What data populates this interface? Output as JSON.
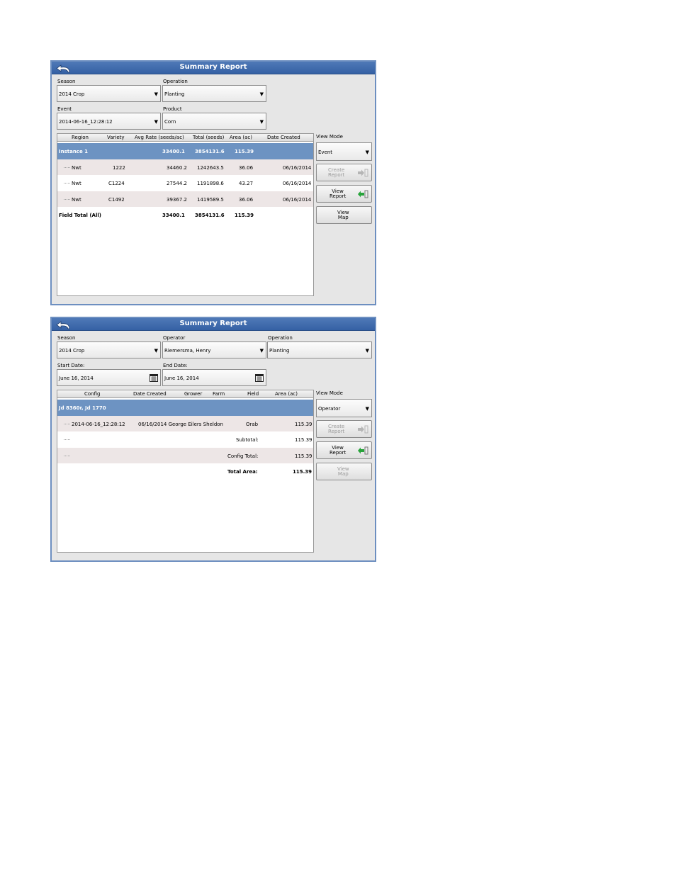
{
  "screen1": {
    "title": "Summary Report",
    "season": {
      "label": "Season",
      "value": "2014 Crop"
    },
    "operation": {
      "label": "Operation",
      "value": "Planting"
    },
    "event": {
      "label": "Event",
      "value": "2014-06-16_12:28:12"
    },
    "product": {
      "label": "Product",
      "value": "Corn"
    },
    "view_mode": {
      "label": "View Mode",
      "value": "Event"
    },
    "columns": [
      "Region",
      "Variety",
      "Avg Rate (seeds/ac)",
      "Total (seeds)",
      "Area (ac)",
      "Date Created"
    ],
    "group": {
      "name": "Instance 1",
      "avg_rate": "33400.1",
      "total": "3854131.6",
      "area": "115.39"
    },
    "rows": [
      {
        "region": "Nwt",
        "variety": "1222",
        "avg_rate": "34460.2",
        "total": "1242643.5",
        "area": "36.06",
        "date": "06/16/2014"
      },
      {
        "region": "Nwt",
        "variety": "C1224",
        "avg_rate": "27544.2",
        "total": "1191898.6",
        "area": "43.27",
        "date": "06/16/2014"
      },
      {
        "region": "Nwt",
        "variety": "C1492",
        "avg_rate": "39367.2",
        "total": "1419589.5",
        "area": "36.06",
        "date": "06/16/2014"
      }
    ],
    "field_total": {
      "label": "Field Total (All)",
      "avg_rate": "33400.1",
      "total": "3854131.6",
      "area": "115.39"
    },
    "buttons": {
      "create_report": "Create\nReport",
      "view_report": "View\nReport",
      "view_map": "View\nMap"
    }
  },
  "screen2": {
    "title": "Summary Report",
    "season": {
      "label": "Season",
      "value": "2014 Crop"
    },
    "operator": {
      "label": "Operator",
      "value": "Riemersma, Henry"
    },
    "operation": {
      "label": "Operation",
      "value": "Planting"
    },
    "start_date": {
      "label": "Start Date:",
      "value": "June 16, 2014"
    },
    "end_date": {
      "label": "End Date:",
      "value": "June 16, 2014"
    },
    "view_mode": {
      "label": "View Mode",
      "value": "Operator"
    },
    "columns": [
      "Config",
      "Date Created",
      "Grower",
      "Farm",
      "Field",
      "Area (ac)"
    ],
    "group": {
      "name": "Jd 8360r, Jd 1770"
    },
    "row": {
      "config": "2014-06-16_12:28:12",
      "date_grower": "06/16/2014 George Eilers Sheldon",
      "field": "Orab",
      "area": "115.39"
    },
    "subtotal": {
      "label": "Subtotal:",
      "area": "115.39"
    },
    "config_total": {
      "label": "Config Total:",
      "area": "115.39"
    },
    "total_area": {
      "label": "Total Area:",
      "area": "115.39"
    },
    "buttons": {
      "create_report": "Create\nReport",
      "view_report": "View\nReport",
      "view_map": "View\nMap"
    }
  },
  "colors": {
    "titlebar": "#3d69ab",
    "selected_row": "#6d93c2",
    "alt_row": "#ede6e6",
    "panel_bg": "#e6e6e6"
  },
  "icons": [
    "back-arrow-icon",
    "dropdown-arrow-icon",
    "calendar-icon",
    "export-arrow-icon",
    "import-arrow-icon"
  ]
}
